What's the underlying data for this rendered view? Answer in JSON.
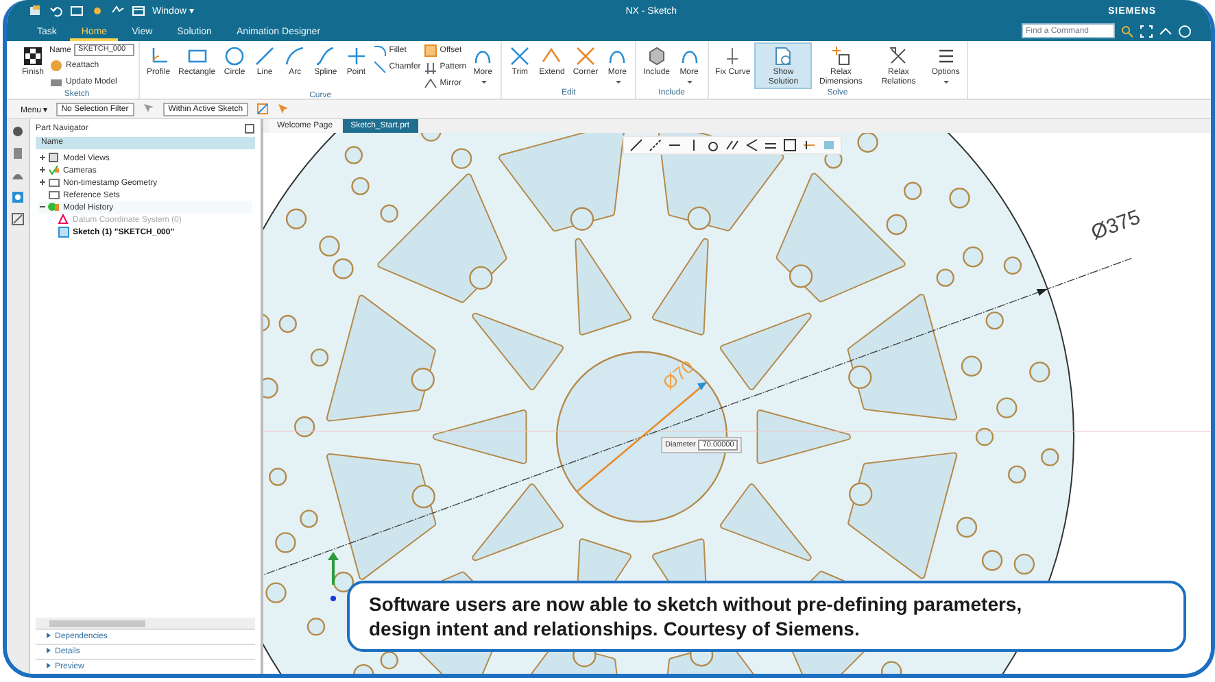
{
  "window": {
    "title": "NX - Sketch",
    "window_menu": "Window ▾",
    "brand": "SIEMENS"
  },
  "ribbon_tabs": [
    {
      "label": "Task",
      "selected": false
    },
    {
      "label": "Home",
      "selected": true
    },
    {
      "label": "View",
      "selected": false
    },
    {
      "label": "Solution",
      "selected": false
    },
    {
      "label": "Animation Designer",
      "selected": false
    }
  ],
  "command_search": {
    "placeholder": "Find a Command"
  },
  "ribbon_groups": [
    {
      "label": "Sketch",
      "items": [
        {
          "kind": "large",
          "label": "Finish"
        },
        {
          "kind": "stack",
          "items": [
            {
              "kind": "field",
              "label": "Name",
              "value": "SKETCH_000"
            },
            {
              "kind": "small",
              "label": "Reattach"
            },
            {
              "kind": "small",
              "label": "Update Model"
            }
          ]
        }
      ]
    },
    {
      "label": "Curve",
      "items": [
        {
          "kind": "large",
          "label": "Profile"
        },
        {
          "kind": "large",
          "label": "Rectangle"
        },
        {
          "kind": "large",
          "label": "Circle"
        },
        {
          "kind": "large",
          "label": "Line"
        },
        {
          "kind": "large",
          "label": "Arc"
        },
        {
          "kind": "large",
          "label": "Spline"
        },
        {
          "kind": "large",
          "label": "Point"
        },
        {
          "kind": "stack",
          "items": [
            {
              "kind": "small",
              "label": "Fillet"
            },
            {
              "kind": "small",
              "label": "Chamfer"
            }
          ]
        },
        {
          "kind": "stack",
          "items": [
            {
              "kind": "small",
              "label": "Offset"
            },
            {
              "kind": "small",
              "label": "Pattern"
            },
            {
              "kind": "small",
              "label": "Mirror"
            }
          ]
        },
        {
          "kind": "menu",
          "label": "More"
        }
      ]
    },
    {
      "label": "Edit",
      "items": [
        {
          "kind": "large",
          "label": "Trim"
        },
        {
          "kind": "large",
          "label": "Extend"
        },
        {
          "kind": "large",
          "label": "Corner"
        },
        {
          "kind": "menu",
          "label": "More"
        }
      ]
    },
    {
      "label": "Include",
      "items": [
        {
          "kind": "large",
          "label": "Include"
        },
        {
          "kind": "menu",
          "label": "More"
        }
      ]
    },
    {
      "label": "Solve",
      "items": [
        {
          "kind": "large",
          "label": "Fix Curve",
          "active": false
        },
        {
          "kind": "large",
          "label": "Show Solution",
          "active": true
        },
        {
          "kind": "large",
          "label": "Relax Dimensions",
          "active": false
        },
        {
          "kind": "large",
          "label": "Relax Relations",
          "active": false
        },
        {
          "kind": "menu",
          "label": "Options",
          "active": false
        }
      ]
    }
  ],
  "toolbar": {
    "menu": "Menu ▾",
    "selection_filter": "No Selection Filter",
    "scope": "Within Active Sketch"
  },
  "navigator": {
    "title": "Part Navigator",
    "column": "Name",
    "tree": [
      {
        "label": "Model Views",
        "has_children": true,
        "expanded": false
      },
      {
        "label": "Cameras",
        "has_children": true,
        "expanded": false
      },
      {
        "label": "Non-timestamp Geometry",
        "has_children": true,
        "expanded": false
      },
      {
        "label": "Reference Sets",
        "has_children": false
      },
      {
        "label": "Model History",
        "has_children": true,
        "expanded": true,
        "children": [
          {
            "label": "Datum Coordinate System (0)",
            "disabled": true,
            "current": false
          },
          {
            "label": "Sketch (1) \"SKETCH_000\"",
            "disabled": false,
            "current": true
          }
        ]
      }
    ],
    "panels": [
      "Dependencies",
      "Details",
      "Preview"
    ]
  },
  "document_tabs": [
    {
      "label": "Welcome Page",
      "selected": false
    },
    {
      "label": "Sketch_Start.prt",
      "selected": true
    }
  ],
  "canvas": {
    "outer_dimension": "Ø375",
    "hub_dimension": "Ø70",
    "diameter_input": {
      "label": "Diameter",
      "value": "70.00000"
    }
  },
  "caption": "Software users are now able to sketch without pre-defining parameters, design intent and relationships. Courtesy of Siemens."
}
